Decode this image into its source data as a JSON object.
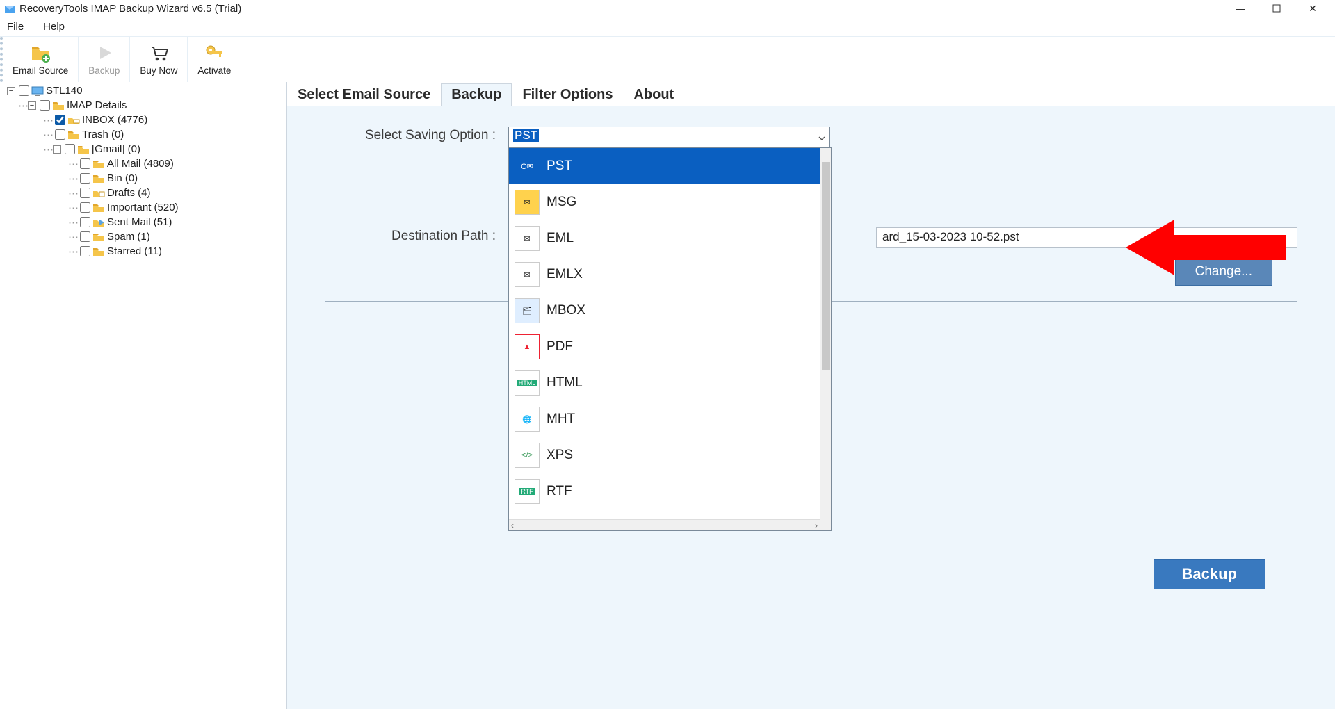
{
  "window": {
    "title": "RecoveryTools IMAP Backup Wizard v6.5 (Trial)"
  },
  "menu": {
    "file": "File",
    "help": "Help"
  },
  "toolbar": {
    "email_source": "Email Source",
    "backup": "Backup",
    "buy_now": "Buy Now",
    "activate": "Activate"
  },
  "tree": {
    "root": "STL140",
    "imap": "IMAP Details",
    "inbox": "INBOX (4776)",
    "trash": "Trash (0)",
    "gmail": "[Gmail] (0)",
    "all_mail": "All Mail (4809)",
    "bin": "Bin (0)",
    "drafts": "Drafts (4)",
    "important": "Important (520)",
    "sent_mail": "Sent Mail (51)",
    "spam": "Spam (1)",
    "starred": "Starred (11)"
  },
  "tabs": {
    "select_source": "Select Email Source",
    "backup": "Backup",
    "filter": "Filter Options",
    "about": "About"
  },
  "form": {
    "saving_label": "Select Saving Option :",
    "saving_value": "PST",
    "dest_label": "Destination Path :",
    "dest_value": "ard_15-03-2023 10-52.pst",
    "change_btn": "Change...",
    "backup_btn": "Backup"
  },
  "dropdown": {
    "options": [
      "PST",
      "MSG",
      "EML",
      "EMLX",
      "MBOX",
      "PDF",
      "HTML",
      "MHT",
      "XPS",
      "RTF"
    ],
    "selected": "PST"
  }
}
